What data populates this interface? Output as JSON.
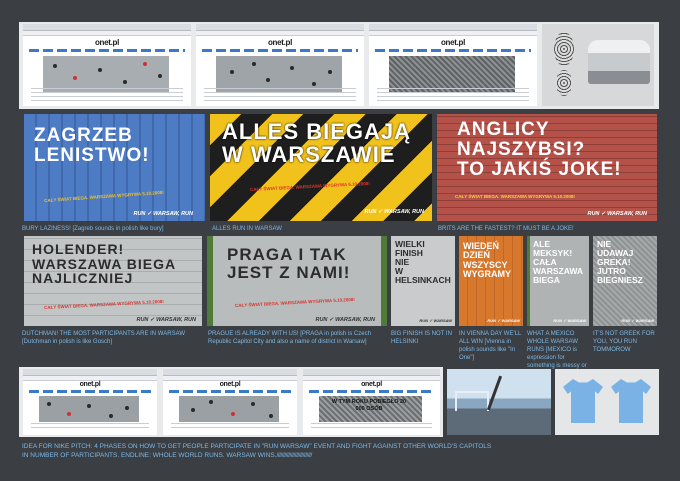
{
  "row1": {
    "browsers": [
      {
        "logo": "onet.pl"
      },
      {
        "logo": "onet.pl"
      },
      {
        "logo": "onet.pl"
      }
    ]
  },
  "billboards": {
    "zagrzeb": {
      "headline": "ZAGRZEB\nLENISTWO!",
      "sub": "CAŁY ŚWIAT BIEGA. WARSZAWA WYGRYWA 5.10.2008!",
      "logo": "RUN ✓ WARSAW, RUN"
    },
    "alles": {
      "headline": "ALLES BIEGAJĄ\nW WARSZAWIE",
      "sub": "CAŁY ŚWIAT BIEGA. WARSZAWA WYGRYWA 5.10.2008!",
      "logo": "RUN ✓ WARSAW, RUN"
    },
    "angl": {
      "headline": "ANGLICY\nNAJSZYBSI?\nTO JAKIŚ JOKE!",
      "sub": "CAŁY ŚWIAT BIEGA. WARSZAWA WYGRYWA 5.10.2008!",
      "logo": "RUN ✓ WARSAW, RUN"
    },
    "holender": {
      "headline": "HOLENDER!\nWARSZAWA BIEGA\nNAJLICZNIEJ",
      "sub": "CAŁY ŚWIAT BIEGA. WARSZAWA WYGRYWA 5.10.2008!",
      "logo": "RUN ✓ WARSAW, RUN"
    },
    "praga": {
      "headline": "PRAGA I TAK\nJEST Z NAMI!",
      "sub": "CAŁY ŚWIAT BIEGA. WARSZAWA WYGRYWA 5.10.2008!",
      "logo": "RUN ✓ WARSAW, RUN"
    },
    "wielki": {
      "headline": "WIELKI\nFINISH\nNIE\nW\nHELSINKACH",
      "logo": "RUN ✓ WARSAW"
    },
    "wieden": {
      "headline": "WIEDEŃ\nDZIEŃ\nWSZYSCY\nWYGRAMY",
      "logo": "RUN ✓ WARSAW"
    },
    "meksyk": {
      "headline": "ALE\nMEKSYK!\nCAŁA\nWARSZAWA\nBIEGA",
      "logo": "RUN ✓ WARSAW"
    },
    "grek": {
      "headline": "NIE\nUDAWAJ\nGREKA!\nJUTRO\nBIEGNIESZ",
      "logo": "RUN ✓ WARSAW"
    }
  },
  "captions": {
    "c1_upper": "BURY LAZINESS!",
    "c1_plain": " [Zagreb sounds in polish like bury]",
    "c2": "ALLES RUN IN WARSAW",
    "c3": "BRITS ARE THE FASTEST? IT MUST BE A JOKE!",
    "c4_upper": "DUTCHMAN! THE MOST PARTICIPANTS ARE IN WARSAW",
    "c4_plain": " [Dutchman in polish is like Gosch]",
    "c5_upper": "PRAGUE IS ALREADY WITH US!",
    "c5_plain": " [PRAGA in polish is Czech Republic Capitol City and also a  name of district in Warsaw]",
    "c6": "BIG FINISH IS NOT IN HELSINKI",
    "c7_upper": "IN VIENNA DAY WE'LL ALL WIN",
    "c7_plain": " [Vienna in polish sounds like \"In One\"]",
    "c8_upper": "WHAT A MEXICO WHOLE WARSAW RUNS",
    "c8_plain": " [MEXICO is expression for something is messy or massive]",
    "c9": "IT'S NOT GREEK FOR YOU, YOU RUN TOMMOROW"
  },
  "row4": {
    "browsers": [
      {
        "logo": "onet.pl"
      },
      {
        "logo": "onet.pl"
      },
      {
        "logo": "onet.pl",
        "overlay": "W TYM ROKU POBIEGŁO 20 000 OSÓB"
      }
    ]
  },
  "footer": {
    "line1": "IDEA FOR NIKE PITCH: 4 PHASES ON HOW TO GET PEOPLE PARTICIPATE IN \"RUN WARSAW\" EVENT AND FIGHT AGAINST OTHER WORLD'S CAPITOLS",
    "line2": "IN NUMBER OF PARTICIPANTS. ENDLINE: WHOLE WORLD RUNS. WARSAW WINS.",
    "slashes": "///////////////////////////"
  },
  "colors": {
    "background": "#3b3e42",
    "caption": "#7db9e8",
    "blue_board": "#4b79c2",
    "yellow_board": "#f2c21c",
    "brick_board": "#b4524a",
    "grey_board": "#b9bcbd"
  }
}
